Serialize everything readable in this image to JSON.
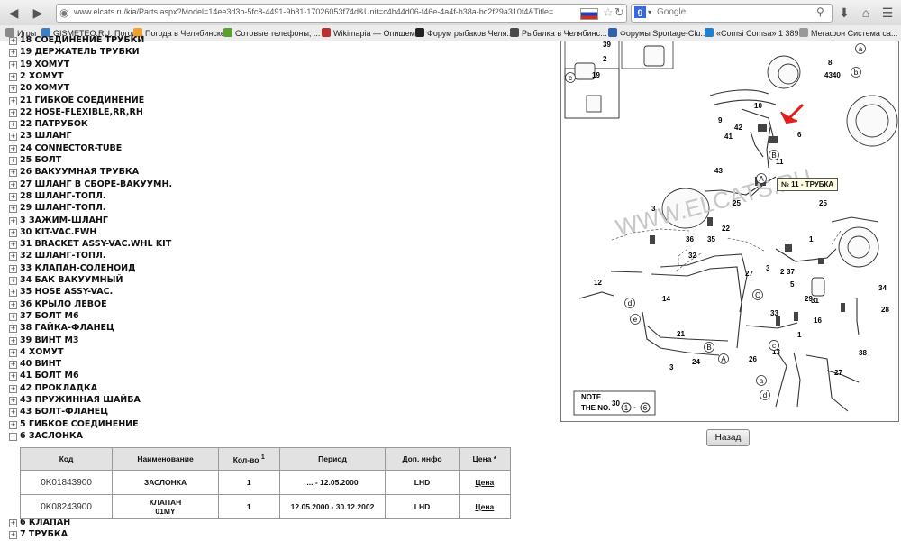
{
  "browser": {
    "url": "www.elcats.ru/kia/Parts.aspx?Model=14ee3d3b-5fc8-4491-9b81-17026053f74d&Unit=c4b44d06-f46e-4a4f-b38a-bc2f29a310f4&Title= (MPI-DOHC);",
    "search_placeholder": "Google",
    "search_engine_icon": "google-icon"
  },
  "bookmarks": [
    {
      "label": "Игры",
      "color": "#8a8a8a"
    },
    {
      "label": "GISMETEO.RU: Погод...",
      "color": "#3b7fc4"
    },
    {
      "label": "Погода в Челябинске",
      "color": "#f0a030"
    },
    {
      "label": "Сотовые телефоны, ...",
      "color": "#5aa02c"
    },
    {
      "label": "Wikimapia — Опишем ...",
      "color": "#c03030"
    },
    {
      "label": "Форум рыбаков Челя...",
      "color": "#222222"
    },
    {
      "label": "Рыбалка в Челябинс...",
      "color": "#4a4a4a"
    },
    {
      "label": "Форумы Sportage-Clu...",
      "color": "#3060b0"
    },
    {
      "label": "«Comsi Comsa» 1 389...",
      "color": "#2080d0"
    },
    {
      "label": "Мегафон Система са...",
      "color": "#999999"
    }
  ],
  "tree": [
    {
      "toggle": "+",
      "label": "18  СОЕДИНЕНИЕ ТРУБКИ"
    },
    {
      "toggle": "+",
      "label": "19  ДЕРЖАТЕЛЬ ТРУБКИ"
    },
    {
      "toggle": "+",
      "label": "19  ХОМУТ"
    },
    {
      "toggle": "+",
      "label": "2  ХОМУТ"
    },
    {
      "toggle": "+",
      "label": "20  ХОМУТ"
    },
    {
      "toggle": "+",
      "label": "21  ГИБКОЕ СОЕДИНЕНИЕ"
    },
    {
      "toggle": "+",
      "label": "22  HOSE-FLEXIBLE,RR,RH"
    },
    {
      "toggle": "+",
      "label": "22  ПАТРУБОК"
    },
    {
      "toggle": "+",
      "label": "23  ШЛАНГ"
    },
    {
      "toggle": "+",
      "label": "24  CONNECTOR-TUBE"
    },
    {
      "toggle": "+",
      "label": "25  БОЛТ"
    },
    {
      "toggle": "+",
      "label": "26  ВАКУУМНАЯ ТРУБКА"
    },
    {
      "toggle": "+",
      "label": "27  ШЛАНГ В СБОРЕ-ВАКУУМН."
    },
    {
      "toggle": "+",
      "label": "28  ШЛАНГ-ТОПЛ."
    },
    {
      "toggle": "+",
      "label": "29  ШЛАНГ-ТОПЛ."
    },
    {
      "toggle": "+",
      "label": "3  ЗАЖИМ-ШЛАНГ"
    },
    {
      "toggle": "+",
      "label": "30  KIT-VAC.FWH"
    },
    {
      "toggle": "+",
      "label": "31  BRACKET ASSY-VAC.WHL KIT"
    },
    {
      "toggle": "+",
      "label": "32  ШЛАНГ-ТОПЛ."
    },
    {
      "toggle": "+",
      "label": "33  КЛАПАН-СОЛЕНОИД"
    },
    {
      "toggle": "+",
      "label": "34  БАК ВАКУУМНЫЙ"
    },
    {
      "toggle": "+",
      "label": "35  HOSE ASSY-VAC."
    },
    {
      "toggle": "+",
      "label": "36  КРЫЛО ЛЕВОЕ"
    },
    {
      "toggle": "+",
      "label": "37  БОЛТ М6"
    },
    {
      "toggle": "+",
      "label": "38  ГАЙКА-ФЛАНЕЦ"
    },
    {
      "toggle": "+",
      "label": "39  ВИНТ М3"
    },
    {
      "toggle": "+",
      "label": "4  ХОМУТ"
    },
    {
      "toggle": "+",
      "label": "40  ВИНТ"
    },
    {
      "toggle": "+",
      "label": "41  БОЛТ М6"
    },
    {
      "toggle": "+",
      "label": "42  ПРОКЛАДКА"
    },
    {
      "toggle": "+",
      "label": "43  ПРУЖИННАЯ ШАЙБА"
    },
    {
      "toggle": "+",
      "label": "43  БОЛТ-ФЛАНЕЦ"
    },
    {
      "toggle": "+",
      "label": "5  ГИБКОЕ СОЕДИНЕНИЕ"
    },
    {
      "toggle": "−",
      "label": "6  ЗАСЛОНКА"
    }
  ],
  "tree_after": [
    {
      "toggle": "+",
      "label": "6  КЛАПАН"
    },
    {
      "toggle": "+",
      "label": "7  ТРУБКА"
    }
  ],
  "table": {
    "headers": [
      "Код",
      "Наименование",
      "Кол-во",
      "Период",
      "Доп. инфо",
      "Цена *"
    ],
    "qty_note": "1",
    "rows": [
      {
        "code": "0K01843900",
        "name": "ЗАСЛОНКА",
        "name2": "",
        "qty": "1",
        "period": "... - 12.05.2000",
        "info": "LHD",
        "price": "Цена"
      },
      {
        "code": "0K08243900",
        "name": "КЛАПАН",
        "name2": "01MY",
        "qty": "1",
        "period": "12.05.2000 - 30.12.2002",
        "info": "LHD",
        "price": "Цена"
      }
    ]
  },
  "diagram": {
    "watermark": "WWW.ELCATS.RU",
    "tooltip": "№ 11 - ТРУБКА",
    "note_label": "NOTE",
    "note_text": "THE NO.",
    "note_num": "30",
    "note_range_from": "1",
    "note_range_to": "6",
    "callouts": [
      "39",
      "2",
      "19",
      "8",
      "4340",
      "10",
      "9",
      "42",
      "41",
      "6",
      "11",
      "43",
      "3",
      "25",
      "22",
      "35",
      "36",
      "25",
      "1",
      "32",
      "27",
      "12",
      "14",
      "3",
      "37",
      "34",
      "5",
      "29",
      "31",
      "28",
      "33",
      "16",
      "21",
      "3",
      "24",
      "1",
      "26",
      "13",
      "27",
      "38",
      "2"
    ],
    "circle_letters": [
      "a",
      "b",
      "c",
      "B",
      "A",
      "C",
      "C",
      "e",
      "d",
      "B",
      "A",
      "c",
      "a",
      "d"
    ],
    "back_label": "Назад",
    "accent_color": "#e02020"
  }
}
